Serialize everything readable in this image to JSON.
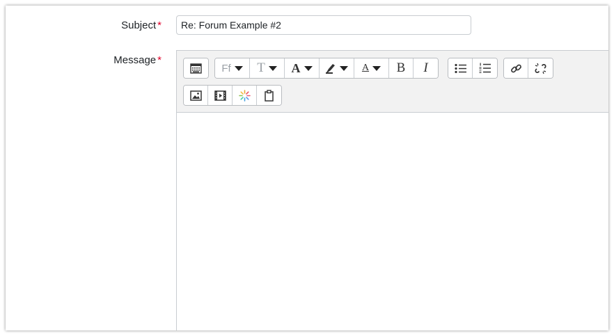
{
  "form": {
    "subject": {
      "label": "Subject",
      "required_mark": "*",
      "value": "Re: Forum Example #2"
    },
    "message": {
      "label": "Message",
      "required_mark": "*"
    }
  },
  "toolbar": {
    "row1": [
      {
        "name": "toolbar-toggle",
        "icon": "show-more-buttons-icon"
      },
      {
        "name": "font-family",
        "icon": "font-family-icon",
        "text": "Ff"
      },
      {
        "name": "font-size",
        "icon": "font-size-icon",
        "text": "T"
      },
      {
        "name": "font-color",
        "icon": "font-color-icon",
        "text": "A"
      },
      {
        "name": "background-color",
        "icon": "highlighter-icon"
      },
      {
        "name": "text-style",
        "icon": "text-style-icon",
        "text": "A"
      },
      {
        "name": "bold",
        "icon": "bold-icon",
        "text": "B"
      },
      {
        "name": "italic",
        "icon": "italic-icon",
        "text": "I"
      },
      {
        "name": "unordered-list",
        "icon": "bullet-list-icon"
      },
      {
        "name": "ordered-list",
        "icon": "numbered-list-icon"
      },
      {
        "name": "link",
        "icon": "link-icon"
      },
      {
        "name": "unlink",
        "icon": "unlink-icon"
      }
    ],
    "row2": [
      {
        "name": "insert-image",
        "icon": "image-icon"
      },
      {
        "name": "insert-media",
        "icon": "media-icon"
      },
      {
        "name": "insert-h5p",
        "icon": "h5p-icon"
      },
      {
        "name": "paste",
        "icon": "clipboard-icon"
      }
    ]
  },
  "colors": {
    "required": "#e0002a",
    "toolbar_bg": "#f2f2f2",
    "border": "#c8ccd0"
  }
}
